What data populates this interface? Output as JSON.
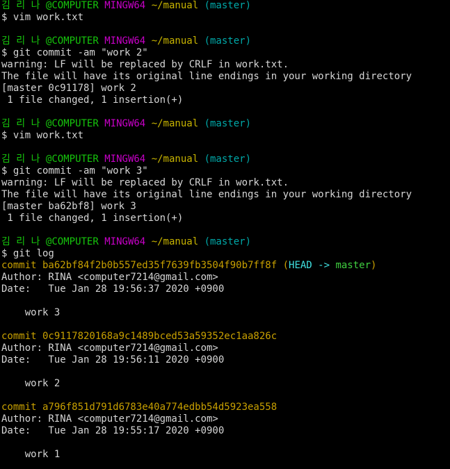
{
  "prompt": {
    "user_host": "김 리 나 @COMPUTER",
    "system": "MINGW64",
    "path": "~/manual",
    "branch": "(master)"
  },
  "lines": [
    {
      "kind": "prompt"
    },
    {
      "kind": "text",
      "text": "$ vim work.txt"
    },
    {
      "kind": "blank"
    },
    {
      "kind": "prompt"
    },
    {
      "kind": "text",
      "text": "$ git commit -am \"work 2\""
    },
    {
      "kind": "text",
      "text": "warning: LF will be replaced by CRLF in work.txt."
    },
    {
      "kind": "text",
      "text": "The file will have its original line endings in your working directory"
    },
    {
      "kind": "text",
      "text": "[master 0c91178] work 2"
    },
    {
      "kind": "text",
      "text": " 1 file changed, 1 insertion(+)"
    },
    {
      "kind": "blank"
    },
    {
      "kind": "prompt"
    },
    {
      "kind": "text",
      "text": "$ vim work.txt"
    },
    {
      "kind": "blank"
    },
    {
      "kind": "prompt"
    },
    {
      "kind": "text",
      "text": "$ git commit -am \"work 3\""
    },
    {
      "kind": "text",
      "text": "warning: LF will be replaced by CRLF in work.txt."
    },
    {
      "kind": "text",
      "text": "The file will have its original line endings in your working directory"
    },
    {
      "kind": "text",
      "text": "[master ba62bf8] work 3"
    },
    {
      "kind": "text",
      "text": " 1 file changed, 1 insertion(+)"
    },
    {
      "kind": "blank"
    },
    {
      "kind": "prompt"
    },
    {
      "kind": "text",
      "text": "$ git log"
    },
    {
      "kind": "commit",
      "text": "commit ba62bf84f2b0b557ed35f7639fb3504f90b7ff8f",
      "ref_open": " (",
      "ref_head": "HEAD -> ",
      "ref_branch": "master",
      "ref_close": ")"
    },
    {
      "kind": "text",
      "text": "Author: RINA <computer7214@gmail.com>"
    },
    {
      "kind": "text",
      "text": "Date:   Tue Jan 28 19:56:37 2020 +0900"
    },
    {
      "kind": "blank"
    },
    {
      "kind": "text",
      "text": "    work 3"
    },
    {
      "kind": "blank"
    },
    {
      "kind": "commit",
      "text": "commit 0c9117820168a9c1489bced53a59352ec1aa826c"
    },
    {
      "kind": "text",
      "text": "Author: RINA <computer7214@gmail.com>"
    },
    {
      "kind": "text",
      "text": "Date:   Tue Jan 28 19:56:11 2020 +0900"
    },
    {
      "kind": "blank"
    },
    {
      "kind": "text",
      "text": "    work 2"
    },
    {
      "kind": "blank"
    },
    {
      "kind": "commit",
      "text": "commit a796f851d791d6783e40a774edbb54d5923ea558"
    },
    {
      "kind": "text",
      "text": "Author: RINA <computer7214@gmail.com>"
    },
    {
      "kind": "text",
      "text": "Date:   Tue Jan 28 19:55:17 2020 +0900"
    },
    {
      "kind": "blank"
    },
    {
      "kind": "text",
      "text": "    work 1"
    }
  ],
  "colors": {
    "background": "#000000",
    "user_host": "#16c60c",
    "system": "#c800c8",
    "path": "#c8b400",
    "branch": "#00a8a8",
    "commit_hash": "#c8a000",
    "head_ref": "#40e0e0",
    "branch_ref": "#40d040"
  }
}
